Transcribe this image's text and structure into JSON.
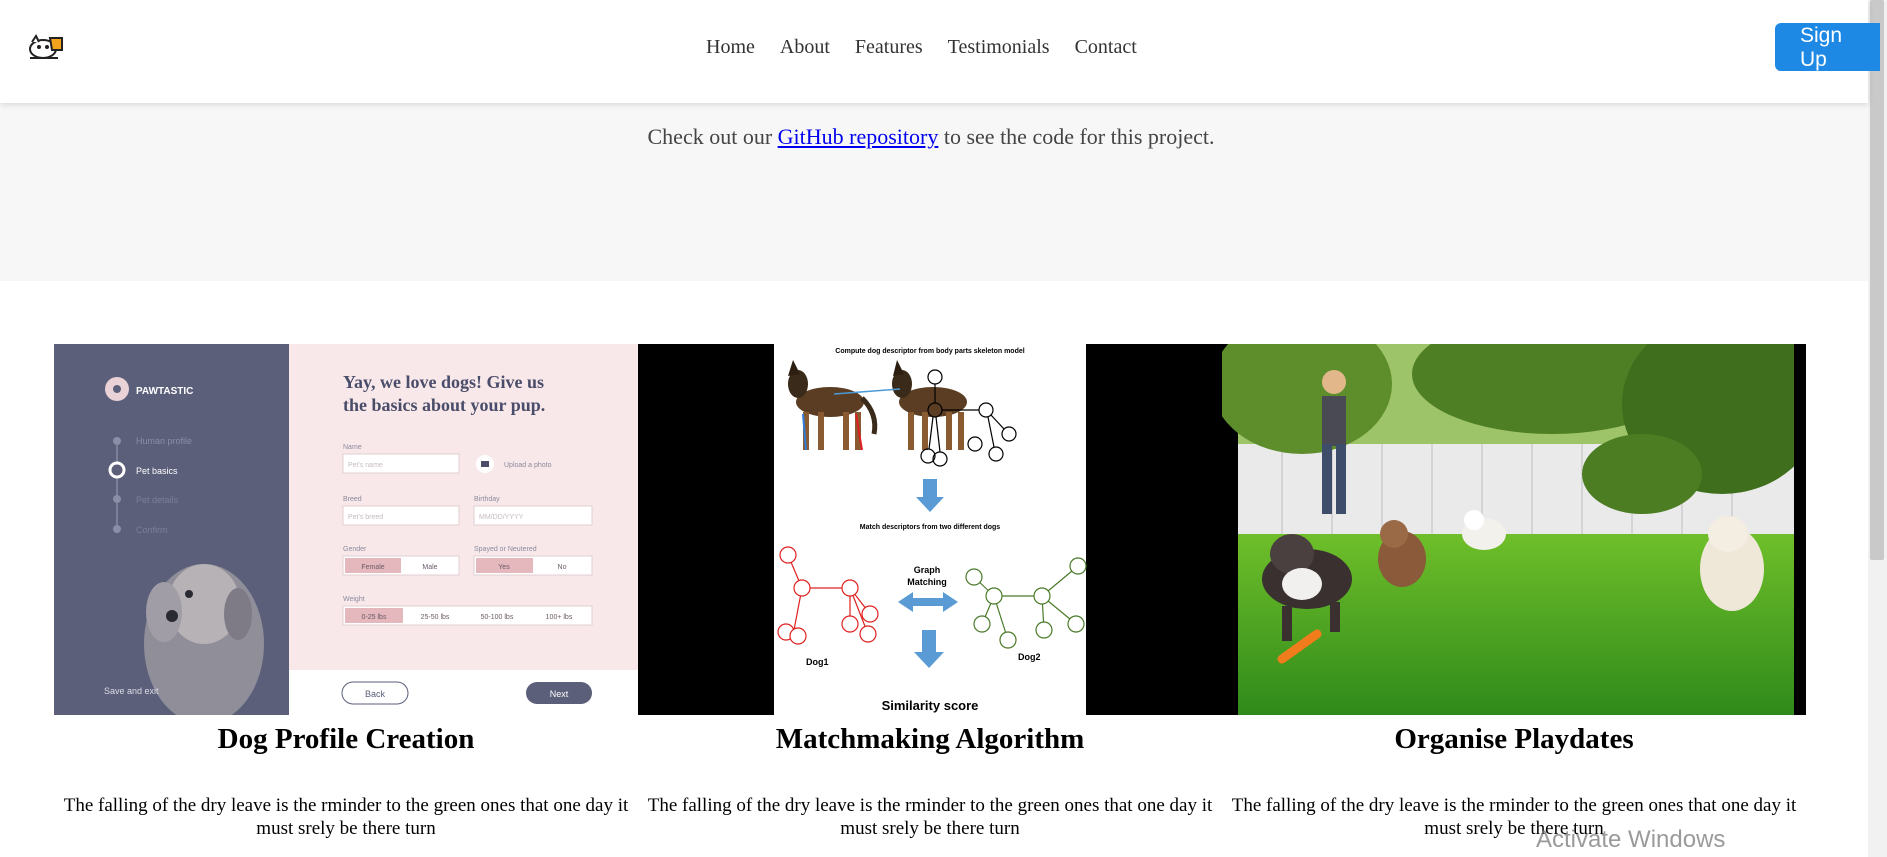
{
  "nav": {
    "items": [
      "Home",
      "About",
      "Features",
      "Testimonials",
      "Contact"
    ],
    "signup_label": "Sign Up"
  },
  "repo": {
    "prefix": "Check out our ",
    "link_text": "GitHub repository",
    "suffix": " to see the code for this project."
  },
  "features": [
    {
      "title": "Dog Profile Creation",
      "description": "The falling of the dry leave is the rminder to the green ones that one day it must srely be there turn",
      "mockup": {
        "brand": "PAWTASTIC",
        "steps": [
          "Human profile",
          "Pet basics",
          "Pet details",
          "Confirm"
        ],
        "save_exit": "Save and exit",
        "heading": "Yay, we love dogs! Give us the basics about your pup.",
        "name_label": "Name",
        "name_placeholder": "Pet's name",
        "upload_label": "Upload a photo",
        "breed_label": "Breed",
        "breed_placeholder": "Pet's breed",
        "birthday_label": "Birthday",
        "birthday_placeholder": "MM/DD/YYYY",
        "gender_label": "Gender",
        "gender_options": [
          "Female",
          "Male"
        ],
        "spayed_label": "Spayed or Neutered",
        "spayed_options": [
          "Yes",
          "No"
        ],
        "weight_label": "Weight",
        "weight_options": [
          "0-25 lbs",
          "25-50 lbs",
          "50-100 lbs",
          "100+ lbs"
        ],
        "back_label": "Back",
        "next_label": "Next"
      }
    },
    {
      "title": "Matchmaking Algorithm",
      "description": "The falling of the dry leave is the rminder to the green ones that one day it must srely be there turn",
      "diagram": {
        "top_caption": "Compute dog descriptor from body parts skeleton model",
        "mid_caption": "Match descriptors from two different dogs",
        "graph_label": "Graph Matching",
        "dog1": "Dog1",
        "dog2": "Dog2",
        "bottom_caption": "Similarity score"
      }
    },
    {
      "title": "Organise Playdates",
      "description": "The falling of the dry leave is the rminder to the green ones that one day it must srely be there turn"
    }
  ],
  "watermark": "Activate Windows",
  "colors": {
    "signup": "#1e88e5",
    "band": "#f7f7f7",
    "mock_sidebar": "#5b5f7a",
    "mock_form": "#f8e8ea"
  }
}
